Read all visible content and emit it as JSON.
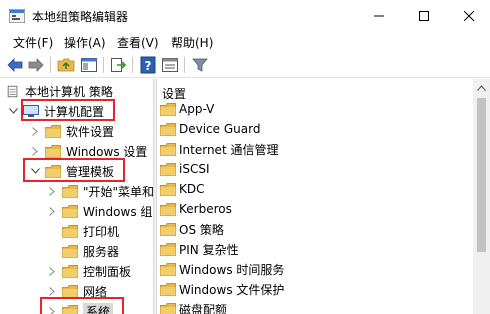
{
  "window": {
    "title": "本地组策略编辑器"
  },
  "menu": [
    {
      "label": "文件(F)"
    },
    {
      "label": "操作(A)"
    },
    {
      "label": "查看(V)"
    },
    {
      "label": "帮助(H)"
    }
  ],
  "tree": {
    "root": "本地计算机 策略",
    "computer_config": "计算机配置",
    "software_settings": "软件设置",
    "windows_settings": "Windows 设置",
    "admin_templates": "管理模板",
    "start_menu": "\"开始\"菜单和",
    "windows_components": "Windows 组",
    "printers": "打印机",
    "server": "服务器",
    "control_panel": "控制面板",
    "network": "网络",
    "system": "系统"
  },
  "right_pane": {
    "header": "设置",
    "items": [
      {
        "label": "App-V"
      },
      {
        "label": "Device Guard"
      },
      {
        "label": "Internet 通信管理"
      },
      {
        "label": "iSCSI"
      },
      {
        "label": "KDC"
      },
      {
        "label": "Kerberos"
      },
      {
        "label": "OS 策略"
      },
      {
        "label": "PIN 复杂性"
      },
      {
        "label": "Windows 时间服务"
      },
      {
        "label": "Windows 文件保护"
      },
      {
        "label": "磁盘配额"
      }
    ]
  },
  "icons": {
    "folder_color": "#e8b84a",
    "highlight_color": "#e8232b"
  }
}
